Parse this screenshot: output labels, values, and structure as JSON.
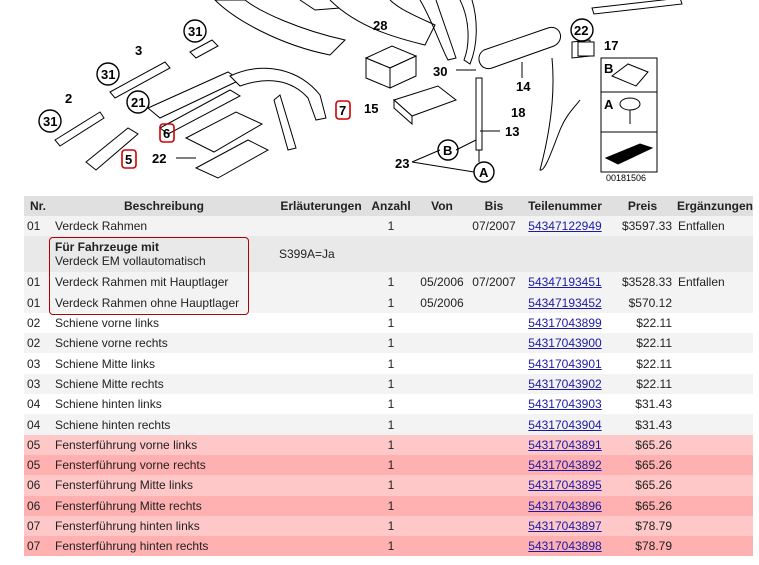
{
  "diagram": {
    "callouts": [
      "2",
      "3",
      "31",
      "31",
      "31",
      "21",
      "5",
      "6",
      "7",
      "22",
      "28",
      "30",
      "15",
      "14",
      "13",
      "23",
      "B",
      "A",
      "18",
      "22",
      "17",
      "B",
      "A"
    ],
    "image_code": "00181506"
  },
  "table": {
    "headers": [
      "Nr.",
      "Beschreibung",
      "Erläuterungen",
      "Anzahl",
      "Von",
      "Bis",
      "Teilenummer",
      "Preis",
      "Ergänzungen"
    ],
    "rows": [
      {
        "type": "row",
        "style": "even",
        "nr": "01",
        "desc": "Verdeck Rahmen",
        "expl": "",
        "qty": "1",
        "from": "",
        "to": "07/2007",
        "part": "54347122949",
        "price": "$3597.33",
        "extra": "Entfallen"
      },
      {
        "type": "note",
        "style": "note",
        "title": "Für Fahrzeuge mit",
        "subtitle": "Verdeck EM vollautomatisch",
        "expl": "S399A=Ja"
      },
      {
        "type": "row",
        "style": "even",
        "nr": "01",
        "desc": "Verdeck Rahmen mit Hauptlager",
        "expl": "",
        "qty": "1",
        "from": "05/2006",
        "to": "07/2007",
        "part": "54347193451",
        "price": "$3528.33",
        "extra": "Entfallen"
      },
      {
        "type": "row",
        "style": "even",
        "nr": "01",
        "desc": "Verdeck Rahmen ohne Hauptlager",
        "expl": "",
        "qty": "1",
        "from": "05/2006",
        "to": "",
        "part": "54347193452",
        "price": "$570.12",
        "extra": ""
      },
      {
        "type": "row",
        "style": "odd",
        "nr": "02",
        "desc": "Schiene vorne links",
        "expl": "",
        "qty": "1",
        "from": "",
        "to": "",
        "part": "54317043899",
        "price": "$22.11",
        "extra": ""
      },
      {
        "type": "row",
        "style": "even",
        "nr": "02",
        "desc": "Schiene vorne rechts",
        "expl": "",
        "qty": "1",
        "from": "",
        "to": "",
        "part": "54317043900",
        "price": "$22.11",
        "extra": ""
      },
      {
        "type": "row",
        "style": "odd",
        "nr": "03",
        "desc": "Schiene Mitte links",
        "expl": "",
        "qty": "1",
        "from": "",
        "to": "",
        "part": "54317043901",
        "price": "$22.11",
        "extra": ""
      },
      {
        "type": "row",
        "style": "even",
        "nr": "03",
        "desc": "Schiene Mitte rechts",
        "expl": "",
        "qty": "1",
        "from": "",
        "to": "",
        "part": "54317043902",
        "price": "$22.11",
        "extra": ""
      },
      {
        "type": "row",
        "style": "odd",
        "nr": "04",
        "desc": "Schiene hinten links",
        "expl": "",
        "qty": "1",
        "from": "",
        "to": "",
        "part": "54317043903",
        "price": "$31.43",
        "extra": ""
      },
      {
        "type": "row",
        "style": "even",
        "nr": "04",
        "desc": "Schiene hinten rechts",
        "expl": "",
        "qty": "1",
        "from": "",
        "to": "",
        "part": "54317043904",
        "price": "$31.43",
        "extra": ""
      },
      {
        "type": "row",
        "style": "hl-a",
        "nr": "05",
        "desc": "Fensterführung vorne links",
        "expl": "",
        "qty": "1",
        "from": "",
        "to": "",
        "part": "54317043891",
        "price": "$65.26",
        "extra": ""
      },
      {
        "type": "row",
        "style": "hl-b",
        "nr": "05",
        "desc": "Fensterführung vorne rechts",
        "expl": "",
        "qty": "1",
        "from": "",
        "to": "",
        "part": "54317043892",
        "price": "$65.26",
        "extra": ""
      },
      {
        "type": "row",
        "style": "hl-a",
        "nr": "06",
        "desc": "Fensterführung Mitte links",
        "expl": "",
        "qty": "1",
        "from": "",
        "to": "",
        "part": "54317043895",
        "price": "$65.26",
        "extra": ""
      },
      {
        "type": "row",
        "style": "hl-b",
        "nr": "06",
        "desc": "Fensterführung Mitte rechts",
        "expl": "",
        "qty": "1",
        "from": "",
        "to": "",
        "part": "54317043896",
        "price": "$65.26",
        "extra": ""
      },
      {
        "type": "row",
        "style": "hl-a",
        "nr": "07",
        "desc": "Fensterführung hinten links",
        "expl": "",
        "qty": "1",
        "from": "",
        "to": "",
        "part": "54317043897",
        "price": "$78.79",
        "extra": ""
      },
      {
        "type": "row",
        "style": "hl-b",
        "nr": "07",
        "desc": "Fensterführung hinten rechts",
        "expl": "",
        "qty": "1",
        "from": "",
        "to": "",
        "part": "54317043898",
        "price": "$78.79",
        "extra": ""
      }
    ]
  },
  "colors": {
    "link": "#1a1aa6",
    "highlight_a": "#ffc8c8",
    "highlight_b": "#ffb0b0",
    "header": "#e0e0e0",
    "callout_box": "#d00000"
  }
}
